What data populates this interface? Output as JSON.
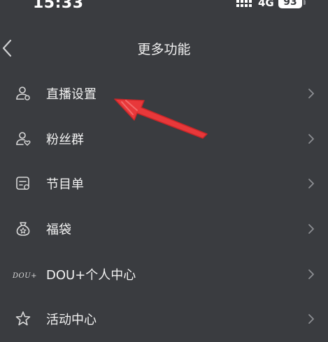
{
  "status_bar": {
    "time": "15:33",
    "network": "4G",
    "battery": "93"
  },
  "header": {
    "title": "更多功能"
  },
  "menu": {
    "items": [
      {
        "label": "直播设置",
        "icon": "user-settings-icon"
      },
      {
        "label": "粉丝群",
        "icon": "fan-group-icon"
      },
      {
        "label": "节目单",
        "icon": "program-list-icon"
      },
      {
        "label": "福袋",
        "icon": "lucky-bag-icon"
      },
      {
        "label": "DOU+个人中心",
        "icon": "dou-plus-icon",
        "icon_text": "DOU+"
      },
      {
        "label": "活动中心",
        "icon": "star-icon"
      }
    ]
  },
  "colors": {
    "background": "#3a3c40",
    "text": "#f2f2f2",
    "icon": "#d8d8d8",
    "chevron": "#8c8e92",
    "annotation": "#e8383a"
  }
}
